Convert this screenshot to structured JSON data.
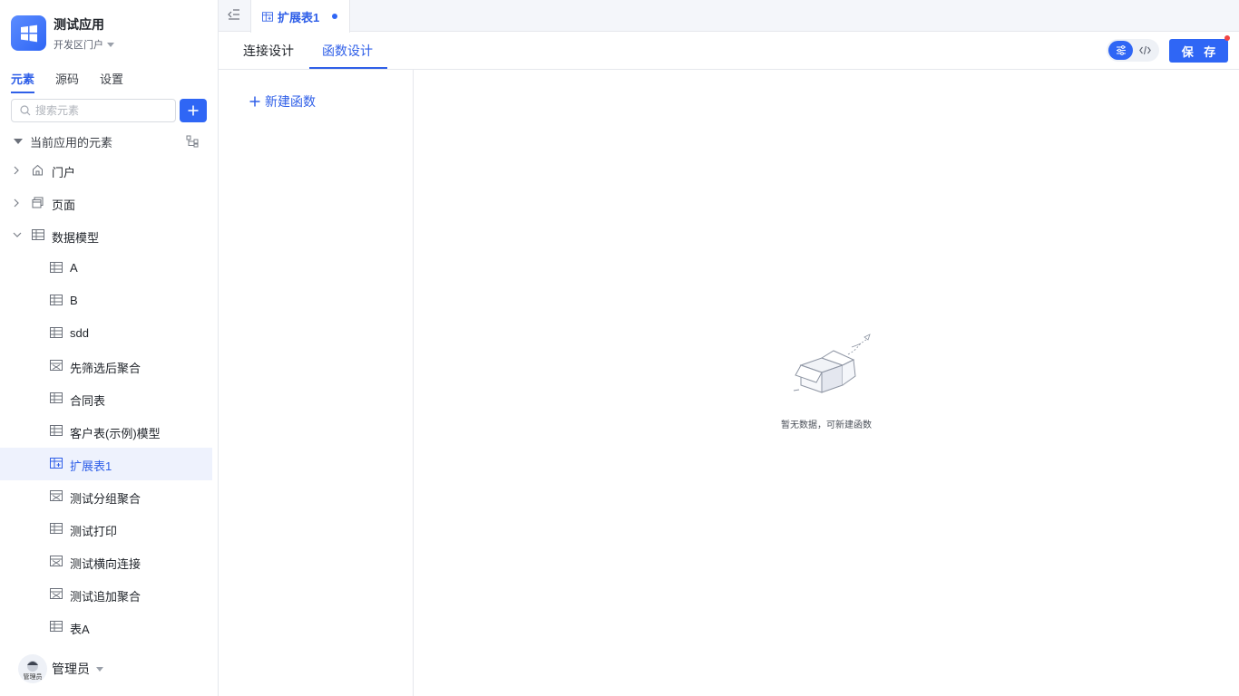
{
  "app": {
    "name": "测试应用",
    "portal": "开发区门户"
  },
  "sidebar": {
    "tabs": [
      "元素",
      "源码",
      "设置"
    ],
    "search_placeholder": "搜索元素",
    "root_label": "当前应用的元素",
    "nodes": [
      {
        "label": "门户",
        "icon": "home-icon"
      },
      {
        "label": "页面",
        "icon": "pages-icon"
      },
      {
        "label": "数据模型",
        "icon": "table-icon"
      }
    ],
    "models": [
      "A",
      "B",
      "sdd",
      "先筛选后聚合",
      "合同表",
      "客户表(示例)模型",
      "扩展表1",
      "测试分组聚合",
      "测试打印",
      "测试横向连接",
      "测试追加聚合",
      "表A"
    ],
    "active_model": "扩展表1"
  },
  "user": {
    "name": "管理员",
    "avatar_text": "管理员"
  },
  "tabbar": {
    "open_tab": "扩展表1"
  },
  "subtabs": {
    "items": [
      "连接设计",
      "函数设计"
    ],
    "active": "函数设计"
  },
  "toolbar": {
    "save_label": "保 存"
  },
  "functions": {
    "new_label": "新建函数"
  },
  "empty": {
    "text": "暂无数据，可新建函数"
  },
  "colors": {
    "primary": "#2f66f5",
    "active_bg": "#eef2fd",
    "badge": "#f24545"
  }
}
